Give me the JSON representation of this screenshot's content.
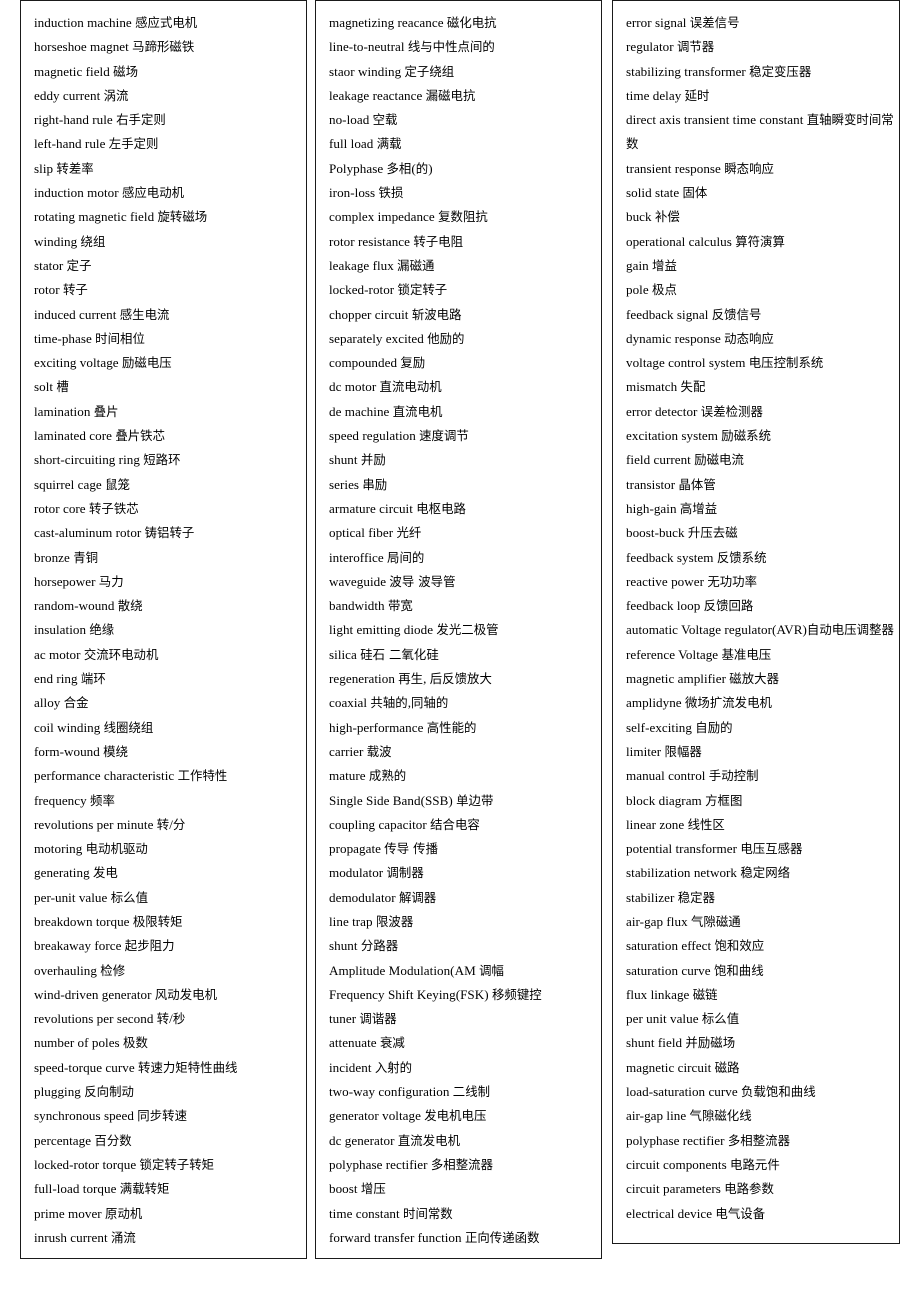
{
  "document": {
    "type": "bilingual-glossary",
    "layout": "three-column-bordered-lists",
    "columns": [
      {
        "name": "column-1",
        "entries": [
          "induction machine  感应式电机",
          "horseshoe magnet  马蹄形磁铁",
          "magnetic field  磁场",
          "eddy current  涡流",
          "right-hand rule  右手定则",
          "left-hand rule  左手定则",
          "slip  转差率",
          "induction motor  感应电动机",
          "rotating magnetic field  旋转磁场",
          "winding  绕组",
          "stator  定子",
          "rotor  转子",
          "induced current  感生电流",
          "time-phase  时间相位",
          "exciting voltage  励磁电压",
          "solt  槽",
          "lamination  叠片",
          "laminated core  叠片铁芯",
          "short-circuiting ring  短路环",
          "squirrel cage  鼠笼",
          "rotor core  转子铁芯",
          "cast-aluminum rotor  铸铝转子",
          "bronze  青铜",
          "horsepower  马力",
          "random-wound  散绕",
          "insulation  绝缘",
          "ac motor  交流环电动机",
          "end ring  端环",
          "alloy  合金",
          "coil winding  线圈绕组",
          "form-wound  模绕",
          "performance characteristic  工作特性",
          "frequency  频率",
          "revolutions per minute  转/分",
          "motoring  电动机驱动",
          "generating  发电",
          "per-unit value  标么值",
          "breakdown torque  极限转矩",
          "breakaway force  起步阻力",
          "overhauling  检修",
          "wind-driven generator  风动发电机",
          "revolutions per second  转/秒",
          "number of poles  极数",
          "speed-torque curve  转速力矩特性曲线",
          "plugging  反向制动",
          "synchronous speed  同步转速",
          "percentage  百分数",
          "locked-rotor torque  锁定转子转矩",
          "full-load torque  满载转矩",
          "prime mover  原动机",
          "inrush current  涌流"
        ]
      },
      {
        "name": "column-2",
        "entries": [
          "magnetizing reacance  磁化电抗",
          "line-to-neutral  线与中性点间的",
          "staor winding  定子绕组",
          "leakage reactance  漏磁电抗",
          "no-load  空载",
          "full load  满载",
          "Polyphase  多相(的)",
          "iron-loss  铁损",
          "complex impedance  复数阻抗",
          "rotor resistance  转子电阻",
          "leakage flux  漏磁通",
          "locked-rotor  锁定转子",
          "chopper circuit  斩波电路",
          "separately excited  他励的",
          "compounded  复励",
          "dc motor  直流电动机",
          "de machine  直流电机",
          "speed regulation  速度调节",
          "shunt  并励",
          "series  串励",
          "armature circuit  电枢电路",
          "optical fiber  光纤",
          "interoffice  局间的",
          "waveguide  波导  波导管",
          "bandwidth  带宽",
          "light emitting diode  发光二极管",
          "silica  硅石  二氧化硅",
          "regeneration  再生, 后反馈放大",
          "coaxial  共轴的,同轴的",
          "high-performance  高性能的",
          "carrier  载波",
          "mature  成熟的",
          "Single Side Band(SSB)  单边带",
          "coupling capacitor  结合电容",
          "propagate  传导  传播",
          "modulator  调制器",
          "demodulator  解调器",
          "line trap  限波器",
          "shunt  分路器",
          "Amplitude Modulation(AM  调幅",
          "Frequency Shift Keying(FSK)  移频键控",
          "tuner  调谐器",
          "attenuate  衰减",
          "incident  入射的",
          "two-way configuration  二线制",
          "generator voltage  发电机电压",
          "dc generator  直流发电机",
          "polyphase rectifier  多相整流器",
          "boost  增压",
          "time constant  时间常数",
          "forward transfer function  正向传递函数"
        ]
      },
      {
        "name": "column-3",
        "entries": [
          "error signal  误差信号",
          "regulator  调节器",
          "stabilizing transformer  稳定变压器",
          "time delay  延时",
          "direct axis transient time constant  直轴瞬变时间常数",
          "transient response  瞬态响应",
          "solid state  固体",
          "buck  补偿",
          "operational calculus  算符演算",
          "gain  增益",
          "pole  极点",
          "feedback signal  反馈信号",
          "dynamic response  动态响应",
          "voltage control system  电压控制系统",
          "mismatch  失配",
          "error detector  误差检测器",
          "excitation system  励磁系统",
          "field current  励磁电流",
          "transistor  晶体管",
          "high-gain  高增益",
          "boost-buck  升压去磁",
          "feedback system  反馈系统",
          "reactive power  无功功率",
          "feedback loop  反馈回路",
          "automatic Voltage regulator(AVR)自动电压调整器",
          "reference Voltage  基准电压",
          "magnetic amplifier  磁放大器",
          "amplidyne  微场扩流发电机",
          "self-exciting  自励的",
          "limiter  限幅器",
          "manual control  手动控制",
          "block diagram  方框图",
          "linear zone  线性区",
          "potential transformer  电压互感器",
          "stabilization network  稳定网络",
          "stabilizer  稳定器",
          "air-gap flux  气隙磁通",
          "saturation effect  饱和效应",
          "saturation curve  饱和曲线",
          "flux linkage  磁链",
          "per unit value  标么值",
          "shunt field  并励磁场",
          "magnetic circuit  磁路",
          "load-saturation curve  负载饱和曲线",
          "air-gap line  气隙磁化线",
          "polyphase rectifier  多相整流器",
          "circuit components  电路元件",
          "circuit parameters  电路参数",
          "electrical device  电气设备"
        ]
      }
    ]
  },
  "colors": {
    "page_background": "#ffffff",
    "text": "#000000",
    "border": "#1a1a1a"
  }
}
